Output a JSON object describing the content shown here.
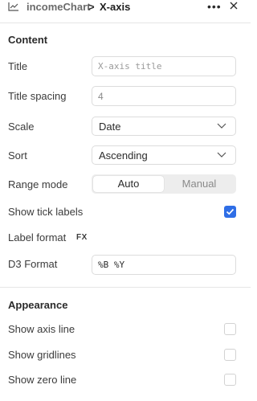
{
  "header": {
    "parent": "incomeChart",
    "separator": ">",
    "current": "X-axis",
    "more_icon": "more-horizontal-icon",
    "close_icon": "close-icon",
    "chart_icon": "line-chart-icon"
  },
  "content": {
    "section_title": "Content",
    "title_label": "Title",
    "title_placeholder": "X-axis title",
    "title_spacing_label": "Title spacing",
    "title_spacing_value": "4",
    "scale_label": "Scale",
    "scale_value": "Date",
    "sort_label": "Sort",
    "sort_value": "Ascending",
    "range_mode_label": "Range mode",
    "range_mode_options": [
      "Auto",
      "Manual"
    ],
    "range_mode_selected": "Auto",
    "show_tick_labels_label": "Show tick labels",
    "show_tick_labels_checked": true,
    "label_format_label": "Label format",
    "label_format_fx": "FX",
    "d3_format_label": "D3 Format",
    "d3_format_value": "%B %Y"
  },
  "appearance": {
    "section_title": "Appearance",
    "show_axis_line_label": "Show axis line",
    "show_axis_line_checked": false,
    "show_gridlines_label": "Show gridlines",
    "show_gridlines_checked": false,
    "show_zero_line_label": "Show zero line",
    "show_zero_line_checked": false
  },
  "colors": {
    "accent": "#2f6ee6",
    "border": "#dcdcdc",
    "divider": "#e6e6e6",
    "segment_bg": "#ededed"
  }
}
